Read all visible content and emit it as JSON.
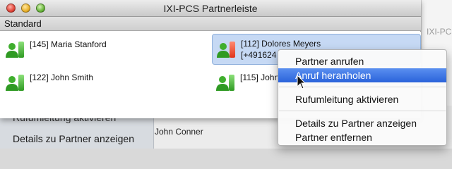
{
  "window": {
    "title": "IXI-PCS Partnerleiste",
    "group_label": "Standard"
  },
  "partners": [
    {
      "label": "[145] Maria Stanford",
      "sub": "",
      "status": "free"
    },
    {
      "label": "[112] Dolores Meyers",
      "sub": "[+491624",
      "status": "busy",
      "selected": true
    },
    {
      "label": "[122] John Smith",
      "sub": "",
      "status": "free"
    },
    {
      "label": "[115] John",
      "sub": "",
      "status": "free"
    }
  ],
  "context_menu": {
    "items": [
      {
        "label": "Partner anrufen"
      },
      {
        "label": "Anruf heranholen",
        "highlighted": true
      },
      {
        "label": "Rufumleitung aktivieren"
      },
      {
        "label": "Details zu Partner anzeigen"
      },
      {
        "label": "Partner entfernen"
      }
    ]
  },
  "background": {
    "sidebar_items": [
      "Rufumleitung aktivieren",
      "Details zu Partner anzeigen"
    ],
    "list_text": "John Conner",
    "right_label": "IXI-PC",
    "right_top": "||||"
  },
  "colors": {
    "status_free": "#3fae2d",
    "status_busy": "#e0351c",
    "selection": "#c6d9f4",
    "menu_highlight": "#2f6bdc"
  },
  "icons": {
    "person": "person-icon",
    "cursor": "arrow-cursor-icon"
  }
}
